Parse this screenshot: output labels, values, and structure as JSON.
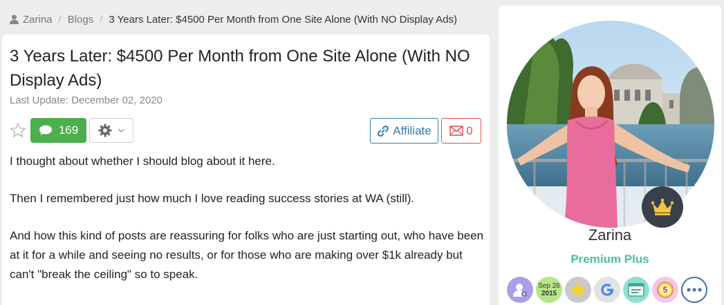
{
  "breadcrumb": {
    "user": "Zarina",
    "section": "Blogs",
    "current": "3 Years Later: $4500 Per Month from One Site Alone (With NO Display Ads)"
  },
  "post": {
    "title": "3 Years Later: $4500 Per Month from One Site Alone (With NO Display Ads)",
    "last_update": "Last Update: December 02, 2020",
    "paragraphs": [
      "I thought about whether I should blog about it here.",
      "Then I remembered just how much I love reading success stories at WA (still).",
      "And how this kind of posts are reassuring for folks who are just starting out, who have been at it for a while and seeing no results, or for those who are making over $1k already but can't \"break the ceiling\" so to speak."
    ]
  },
  "toolbar": {
    "comments_count": "169",
    "affiliate_label": "Affiliate",
    "mail_count": "0"
  },
  "profile": {
    "name": "Zarina",
    "membership": "Premium Plus",
    "date_badge": {
      "month_day": "Sep 26",
      "year": "2015"
    },
    "badge_number": "5"
  },
  "colors": {
    "comments_green": "#4cae4c",
    "affiliate_blue": "#337ab7",
    "mail_red": "#d9534f",
    "premium_teal": "#49c0a0"
  },
  "icons": [
    "user-icon",
    "star-icon",
    "comment-icon",
    "gear-icon",
    "chevron-down-icon",
    "link-icon",
    "envelope-icon",
    "crown-icon"
  ]
}
